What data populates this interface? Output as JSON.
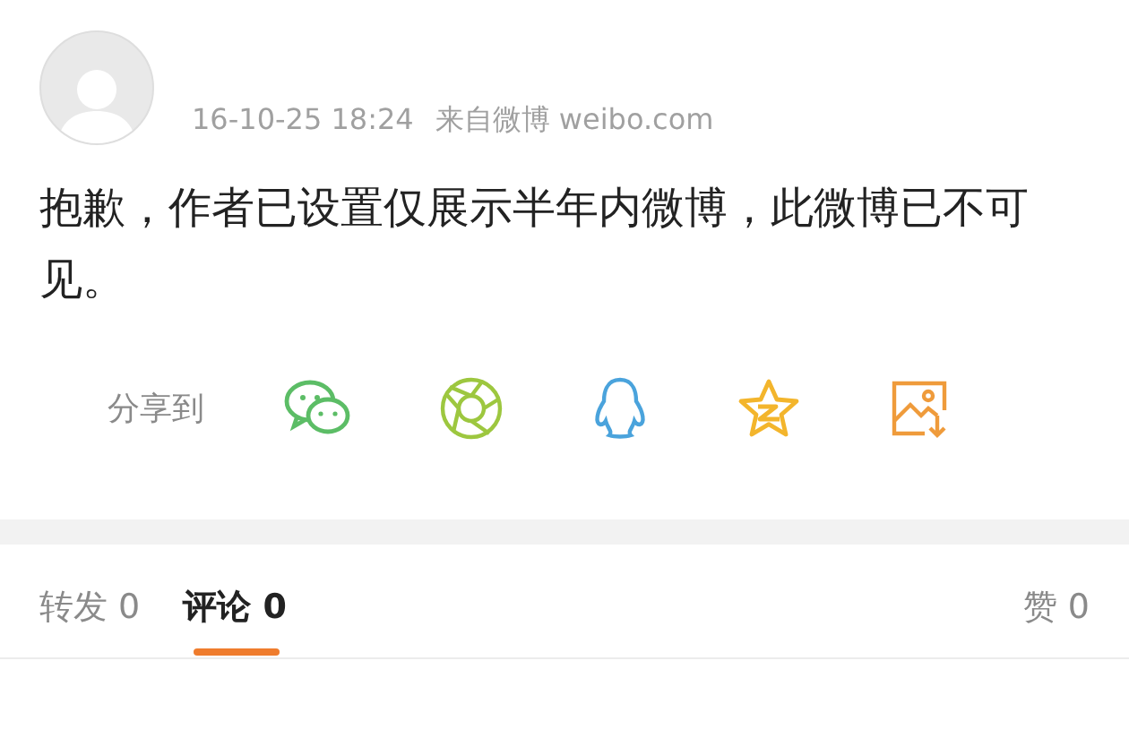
{
  "post": {
    "time": "16-10-25 18:24",
    "source": "来自微博 weibo.com",
    "text": "抱歉，作者已设置仅展示半年内微博，此微博已不可见。"
  },
  "share": {
    "label": "分享到"
  },
  "tabs": [
    {
      "label": "转发 0",
      "selected": false
    },
    {
      "label": "评论 0",
      "selected": true
    },
    {
      "label": "赞 0",
      "selected": false
    }
  ]
}
